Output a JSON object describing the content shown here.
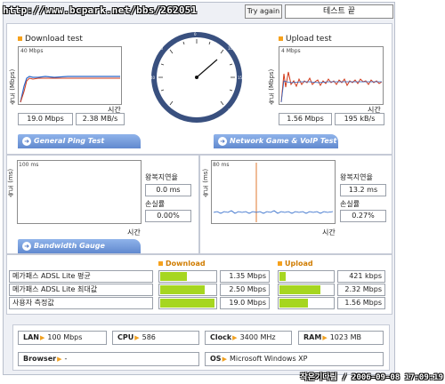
{
  "watermark_url": "http://www.bcpark.net/bbs/262051",
  "toolbar": {
    "try_again_label": "Try again",
    "status_text": "테스트 끝"
  },
  "download": {
    "title": "Download test",
    "scale_label": "40 Mbps",
    "y_axis_label": "속도 (Mbps)",
    "time_label": "시간",
    "speed_mbps": "19.0 Mbps",
    "speed_mbs": "2.38 MB/s"
  },
  "upload": {
    "title": "Upload test",
    "scale_label": "4 Mbps",
    "y_axis_label": "속도 (Mbps)",
    "time_label": "시간",
    "speed_mbps": "1.56 Mbps",
    "speed_kbs": "195 kB/s"
  },
  "tabs": {
    "ping_label": "General Ping Test",
    "game_label": "Network Game & VoIP Test",
    "bandwidth_label": "Bandwidth Gauge"
  },
  "ping": {
    "scale_label": "100 ms",
    "y_axis_label": "속도 (ms)",
    "time_label": "시간",
    "latency_label": "왕복지연율",
    "latency_value": "0.0 ms",
    "loss_label": "손실률",
    "loss_value": "0.00%"
  },
  "game": {
    "scale_label": "80 ms",
    "y_axis_label": "속도 (ms)",
    "time_label": "시간",
    "latency_label": "왕복지연율",
    "latency_value": "13.2 ms",
    "loss_label": "손실률",
    "loss_value": "0.27%"
  },
  "gauge": {
    "download_header": "Download",
    "upload_header": "Upload",
    "rows": [
      {
        "label": "메가패스 ADSL Lite 평균",
        "download": "1.35 Mbps",
        "download_fill": 0.5,
        "upload": "421 kbps",
        "upload_fill": 0.15
      },
      {
        "label": "메가패스 ADSL Lite 최대값",
        "download": "2.50 Mbps",
        "download_fill": 0.82,
        "upload": "2.32 Mbps",
        "upload_fill": 0.78
      },
      {
        "label": "사용자 측정값",
        "download": "19.0 Mbps",
        "download_fill": 0.98,
        "upload": "1.56 Mbps",
        "upload_fill": 0.55
      }
    ]
  },
  "sysinfo": {
    "lan_key": "LAN",
    "lan_val": "100 Mbps",
    "cpu_key": "CPU",
    "cpu_val": "586",
    "clock_key": "Clock",
    "clock_val": "3400 MHz",
    "ram_key": "RAM",
    "ram_val": "1023 MB",
    "browser_key": "Browser",
    "browser_val": "-",
    "os_key": "OS",
    "os_val": "Microsoft Windows XP"
  },
  "timestamp_text": "작은기다림 / 2006-09-08 17:09:19",
  "colors": {
    "accent_orange": "#f6a11c",
    "bar_green": "#a6d620",
    "tab_blue": "#6189cf",
    "dl_line": "#2a66c8",
    "ul_line": "#d23a1a"
  },
  "icons": [
    "arrow-circle-icon",
    "orange-square-icon",
    "orange-arrow-icon"
  ]
}
